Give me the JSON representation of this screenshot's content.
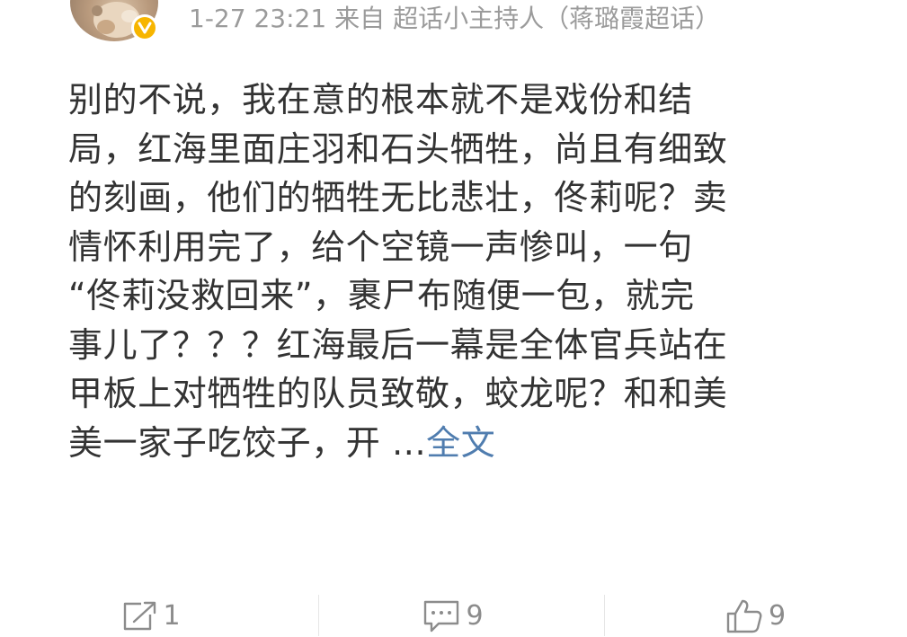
{
  "post": {
    "meta": {
      "time": "1-27 23:21",
      "source_prefix": "来自",
      "source": "超话小主持人（蒋璐霞超话）"
    },
    "content_lines": [
      "别的不说，我在意的根本就不是戏份和结",
      "局，红海里面庄羽和石头牺牲，尚且有细致",
      "的刻画，他们的牺牲无比悲壮，佟莉呢？卖",
      "情怀利用完了，给个空镜一声惨叫，一句",
      "“佟莉没救回来”，裹尸布随便一包，就完",
      "事儿了？？？红海最后一幕是全体官兵站在",
      "甲板上对牺牲的队员致敬，蛟龙呢？和和美",
      "美一家子吃饺子，开 ..."
    ],
    "full_text_link": "全文",
    "actions": {
      "repost": {
        "icon": "repost-icon",
        "count": "1"
      },
      "comment": {
        "icon": "comment-icon",
        "count": "9"
      },
      "like": {
        "icon": "thumbs-up-icon",
        "count": "9"
      }
    },
    "colors": {
      "text": "#333333",
      "meta": "#9b9b9b",
      "link": "#507daf",
      "verified_badge": "#f7b500",
      "action": "#8c8c8c"
    }
  }
}
